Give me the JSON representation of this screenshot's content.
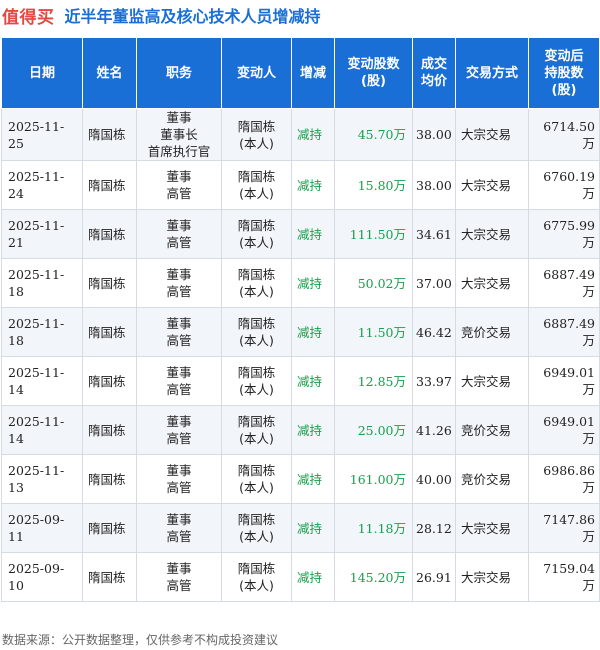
{
  "header": {
    "brand": "值得买",
    "title": "近半年董监高及核心技术人员增减持"
  },
  "table": {
    "columns": [
      "日期",
      "姓名",
      "职务",
      "变动人",
      "增减",
      "变动股数\n(股)",
      "成交\n均价",
      "交易方式",
      "变动后\n持股数\n(股)"
    ],
    "rows": [
      {
        "date": "2025-11-25",
        "name": "隋国栋",
        "position": "董事\n董事长\n首席执行官",
        "person": "隋国栋\n(本人)",
        "action": "减持",
        "shares": "45.70万",
        "price": "38.00",
        "mode": "大宗交易",
        "after": "6714.50万"
      },
      {
        "date": "2025-11-24",
        "name": "隋国栋",
        "position": "董事\n高管",
        "person": "隋国栋\n(本人)",
        "action": "减持",
        "shares": "15.80万",
        "price": "38.00",
        "mode": "大宗交易",
        "after": "6760.19万"
      },
      {
        "date": "2025-11-21",
        "name": "隋国栋",
        "position": "董事\n高管",
        "person": "隋国栋\n(本人)",
        "action": "减持",
        "shares": "111.50万",
        "price": "34.61",
        "mode": "大宗交易",
        "after": "6775.99万"
      },
      {
        "date": "2025-11-18",
        "name": "隋国栋",
        "position": "董事\n高管",
        "person": "隋国栋\n(本人)",
        "action": "减持",
        "shares": "50.02万",
        "price": "37.00",
        "mode": "大宗交易",
        "after": "6887.49万"
      },
      {
        "date": "2025-11-18",
        "name": "隋国栋",
        "position": "董事\n高管",
        "person": "隋国栋\n(本人)",
        "action": "减持",
        "shares": "11.50万",
        "price": "46.42",
        "mode": "竞价交易",
        "after": "6887.49万"
      },
      {
        "date": "2025-11-14",
        "name": "隋国栋",
        "position": "董事\n高管",
        "person": "隋国栋\n(本人)",
        "action": "减持",
        "shares": "12.85万",
        "price": "33.97",
        "mode": "大宗交易",
        "after": "6949.01万"
      },
      {
        "date": "2025-11-14",
        "name": "隋国栋",
        "position": "董事\n高管",
        "person": "隋国栋\n(本人)",
        "action": "减持",
        "shares": "25.00万",
        "price": "41.26",
        "mode": "竞价交易",
        "after": "6949.01万"
      },
      {
        "date": "2025-11-13",
        "name": "隋国栋",
        "position": "董事\n高管",
        "person": "隋国栋\n(本人)",
        "action": "减持",
        "shares": "161.00万",
        "price": "40.00",
        "mode": "竞价交易",
        "after": "6986.86万"
      },
      {
        "date": "2025-09-11",
        "name": "隋国栋",
        "position": "董事\n高管",
        "person": "隋国栋\n(本人)",
        "action": "减持",
        "shares": "11.18万",
        "price": "28.12",
        "mode": "大宗交易",
        "after": "7147.86万"
      },
      {
        "date": "2025-09-10",
        "name": "隋国栋",
        "position": "董事\n高管",
        "person": "隋国栋\n(本人)",
        "action": "减持",
        "shares": "145.20万",
        "price": "26.91",
        "mode": "大宗交易",
        "after": "7159.04万"
      }
    ]
  },
  "footer": {
    "source": "数据来源：公开数据整理，仅供参考不构成投资建议"
  },
  "colors": {
    "brand": "#e8473f",
    "title": "#1a6fd6",
    "header_bg": "#1a6fd6",
    "reduce": "#19a04a"
  }
}
